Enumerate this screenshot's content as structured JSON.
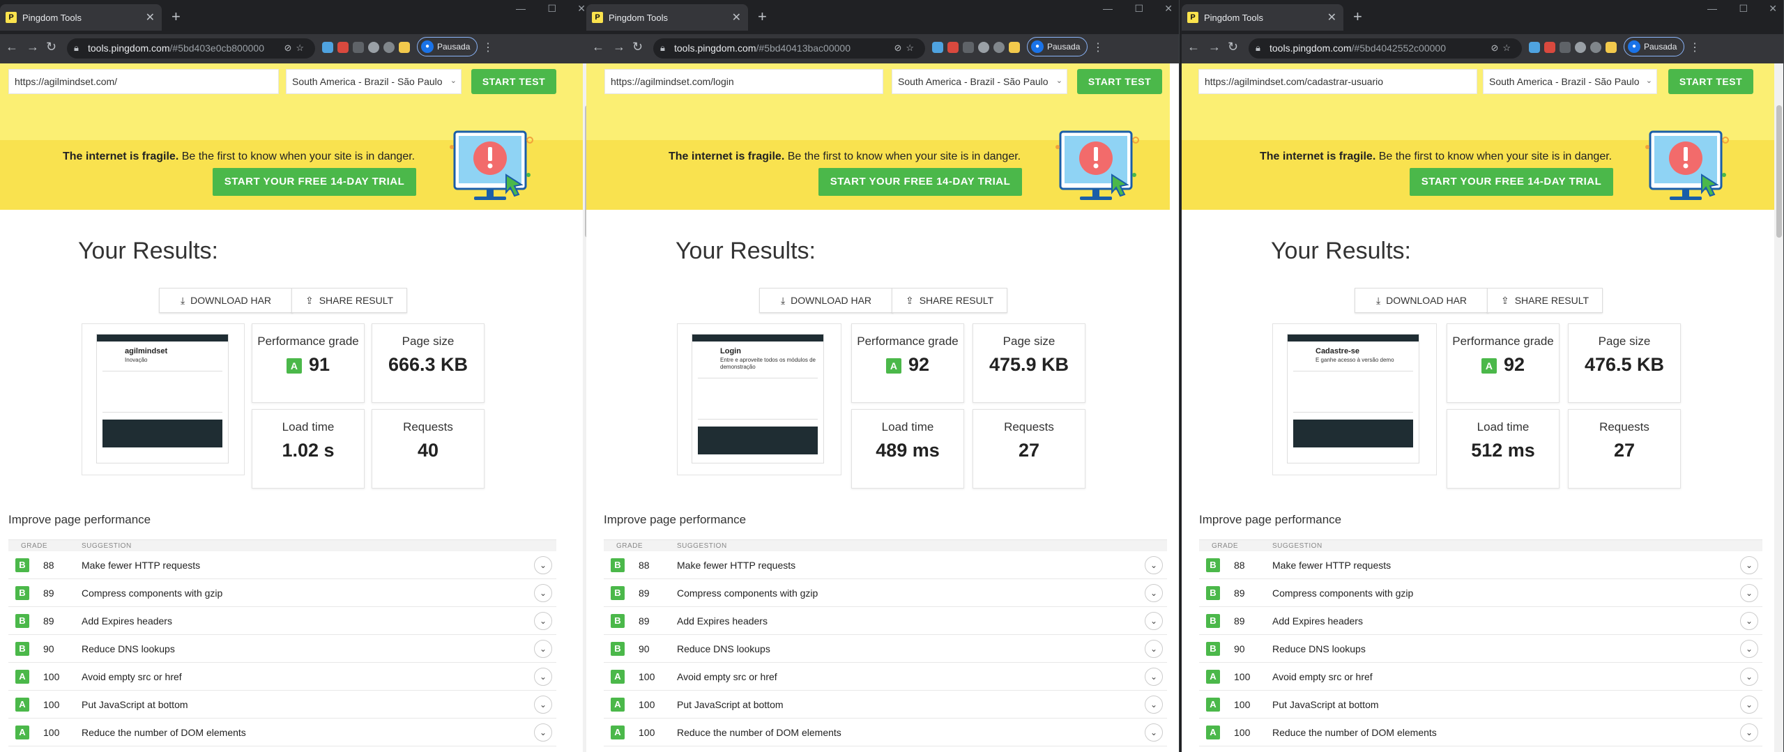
{
  "browser": {
    "tab_title": "Pingdom Tools",
    "favicon_letter": "P",
    "profile_label": "Pausada"
  },
  "page": {
    "location": "South America - Brazil - São Paulo",
    "start_test_label": "START TEST",
    "banner_bold": "The internet is fragile.",
    "banner_rest": " Be the first to know when your site is in danger.",
    "trial_label": "START YOUR FREE 14-DAY TRIAL",
    "results_title": "Your Results:",
    "download_har_label": "DOWNLOAD HAR",
    "share_result_label": "SHARE RESULT",
    "perf_grade_label": "Performance grade",
    "page_size_label": "Page size",
    "load_time_label": "Load time",
    "requests_label": "Requests",
    "improve_title": "Improve page performance",
    "col_grade": "GRADE",
    "col_suggestion": "SUGGESTION",
    "grade_letter": "A",
    "suggestions": [
      {
        "grade": "B",
        "score": "88",
        "text": "Make fewer HTTP requests"
      },
      {
        "grade": "B",
        "score": "89",
        "text": "Compress components with gzip"
      },
      {
        "grade": "B",
        "score": "89",
        "text": "Add Expires headers"
      },
      {
        "grade": "B",
        "score": "90",
        "text": "Reduce DNS lookups"
      },
      {
        "grade": "A",
        "score": "100",
        "text": "Avoid empty src or href"
      },
      {
        "grade": "A",
        "score": "100",
        "text": "Put JavaScript at bottom"
      },
      {
        "grade": "A",
        "score": "100",
        "text": "Reduce the number of DOM elements"
      }
    ]
  },
  "windows": [
    {
      "host": "tools.pingdom.com",
      "path": "/#5bd403e0cb800000",
      "test_url": "https://agilmindset.com/",
      "grade": "91",
      "page_size": "666.3 KB",
      "load_time": "1.02 s",
      "requests": "40",
      "shot_heading": "agilmindset",
      "shot_body": "Inovação"
    },
    {
      "host": "tools.pingdom.com",
      "path": "/#5bd40413bac00000",
      "test_url": "https://agilmindset.com/login",
      "grade": "92",
      "page_size": "475.9 KB",
      "load_time": "489 ms",
      "requests": "27",
      "shot_heading": "Login",
      "shot_body": "Entre e aproveite todos os módulos de demonstração"
    },
    {
      "host": "tools.pingdom.com",
      "path": "/#5bd4042552c00000",
      "test_url": "https://agilmindset.com/cadastrar-usuario",
      "grade": "92",
      "page_size": "476.5 KB",
      "load_time": "512 ms",
      "requests": "27",
      "shot_heading": "Cadastre-se",
      "shot_body": "E ganhe acesso à versão demo"
    }
  ],
  "colors": {
    "accent_green": "#4bb84a",
    "banner_yellow": "#f9e24f",
    "hero_yellow": "#fbef73",
    "chrome_dark": "#202124"
  }
}
